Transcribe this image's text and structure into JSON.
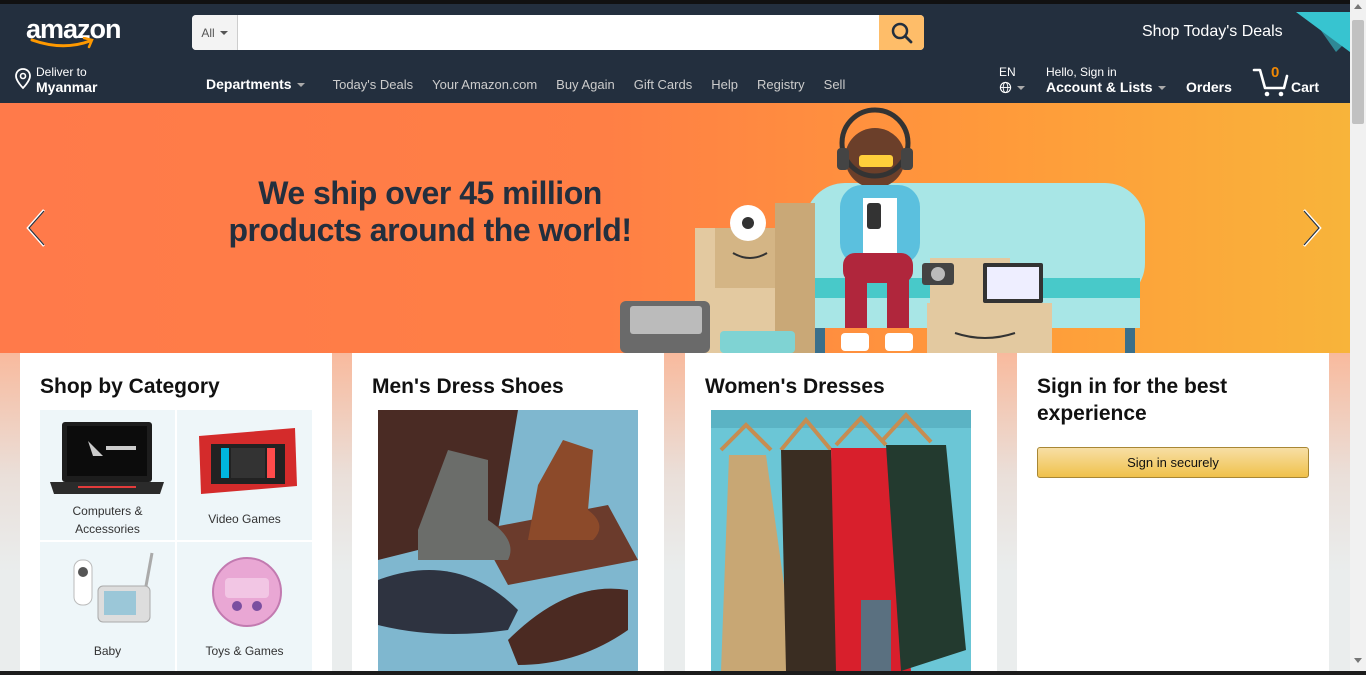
{
  "header": {
    "logo_text": "amazon",
    "search": {
      "category": "All",
      "placeholder": "",
      "value": ""
    },
    "deals_banner": "Shop Today's Deals",
    "deliver": {
      "line1": "Deliver to",
      "line2": "Myanmar"
    },
    "nav_links": [
      "Today's Deals",
      "Your Amazon.com",
      "Buy Again",
      "Gift Cards",
      "Help",
      "Registry",
      "Sell"
    ],
    "departments": "Departments",
    "language": "EN",
    "account": {
      "greeting": "Hello, Sign in",
      "label": "Account & Lists"
    },
    "orders": "Orders",
    "cart": {
      "count": "0",
      "label": "Cart"
    }
  },
  "hero": {
    "title_line1": "We ship over 45 million",
    "title_line2": "products around the world!"
  },
  "cards": {
    "category": {
      "title": "Shop by Category",
      "items": [
        {
          "label_line1": "Computers &",
          "label_line2": "Accessories"
        },
        {
          "label_line1": "Video Games",
          "label_line2": ""
        },
        {
          "label_line1": "Baby",
          "label_line2": ""
        },
        {
          "label_line1": "Toys & Games",
          "label_line2": ""
        }
      ]
    },
    "shoes": {
      "title": "Men's Dress Shoes"
    },
    "dresses": {
      "title": "Women's Dresses"
    },
    "signin": {
      "title_line1": "Sign in for the best",
      "title_line2": "experience",
      "button": "Sign in securely"
    }
  },
  "colors": {
    "nav_bg": "#232f3e",
    "search_button": "#febd69",
    "cart_count": "#f08804",
    "hero_orange": "#ff7a4a"
  }
}
